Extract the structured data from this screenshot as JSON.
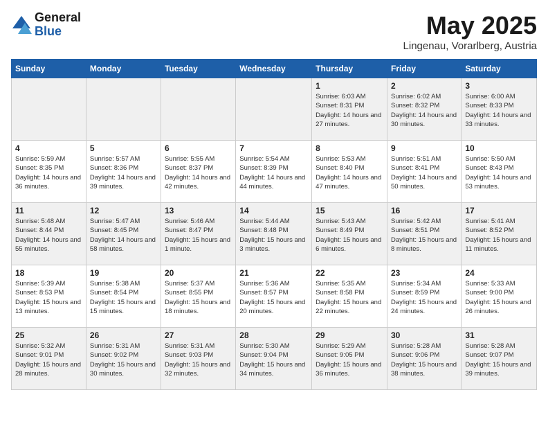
{
  "header": {
    "logo_general": "General",
    "logo_blue": "Blue",
    "month": "May 2025",
    "location": "Lingenau, Vorarlberg, Austria"
  },
  "days_of_week": [
    "Sunday",
    "Monday",
    "Tuesday",
    "Wednesday",
    "Thursday",
    "Friday",
    "Saturday"
  ],
  "weeks": [
    [
      {
        "day": "",
        "info": ""
      },
      {
        "day": "",
        "info": ""
      },
      {
        "day": "",
        "info": ""
      },
      {
        "day": "",
        "info": ""
      },
      {
        "day": "1",
        "info": "Sunrise: 6:03 AM\nSunset: 8:31 PM\nDaylight: 14 hours and 27 minutes."
      },
      {
        "day": "2",
        "info": "Sunrise: 6:02 AM\nSunset: 8:32 PM\nDaylight: 14 hours and 30 minutes."
      },
      {
        "day": "3",
        "info": "Sunrise: 6:00 AM\nSunset: 8:33 PM\nDaylight: 14 hours and 33 minutes."
      }
    ],
    [
      {
        "day": "4",
        "info": "Sunrise: 5:59 AM\nSunset: 8:35 PM\nDaylight: 14 hours and 36 minutes."
      },
      {
        "day": "5",
        "info": "Sunrise: 5:57 AM\nSunset: 8:36 PM\nDaylight: 14 hours and 39 minutes."
      },
      {
        "day": "6",
        "info": "Sunrise: 5:55 AM\nSunset: 8:37 PM\nDaylight: 14 hours and 42 minutes."
      },
      {
        "day": "7",
        "info": "Sunrise: 5:54 AM\nSunset: 8:39 PM\nDaylight: 14 hours and 44 minutes."
      },
      {
        "day": "8",
        "info": "Sunrise: 5:53 AM\nSunset: 8:40 PM\nDaylight: 14 hours and 47 minutes."
      },
      {
        "day": "9",
        "info": "Sunrise: 5:51 AM\nSunset: 8:41 PM\nDaylight: 14 hours and 50 minutes."
      },
      {
        "day": "10",
        "info": "Sunrise: 5:50 AM\nSunset: 8:43 PM\nDaylight: 14 hours and 53 minutes."
      }
    ],
    [
      {
        "day": "11",
        "info": "Sunrise: 5:48 AM\nSunset: 8:44 PM\nDaylight: 14 hours and 55 minutes."
      },
      {
        "day": "12",
        "info": "Sunrise: 5:47 AM\nSunset: 8:45 PM\nDaylight: 14 hours and 58 minutes."
      },
      {
        "day": "13",
        "info": "Sunrise: 5:46 AM\nSunset: 8:47 PM\nDaylight: 15 hours and 1 minute."
      },
      {
        "day": "14",
        "info": "Sunrise: 5:44 AM\nSunset: 8:48 PM\nDaylight: 15 hours and 3 minutes."
      },
      {
        "day": "15",
        "info": "Sunrise: 5:43 AM\nSunset: 8:49 PM\nDaylight: 15 hours and 6 minutes."
      },
      {
        "day": "16",
        "info": "Sunrise: 5:42 AM\nSunset: 8:51 PM\nDaylight: 15 hours and 8 minutes."
      },
      {
        "day": "17",
        "info": "Sunrise: 5:41 AM\nSunset: 8:52 PM\nDaylight: 15 hours and 11 minutes."
      }
    ],
    [
      {
        "day": "18",
        "info": "Sunrise: 5:39 AM\nSunset: 8:53 PM\nDaylight: 15 hours and 13 minutes."
      },
      {
        "day": "19",
        "info": "Sunrise: 5:38 AM\nSunset: 8:54 PM\nDaylight: 15 hours and 15 minutes."
      },
      {
        "day": "20",
        "info": "Sunrise: 5:37 AM\nSunset: 8:55 PM\nDaylight: 15 hours and 18 minutes."
      },
      {
        "day": "21",
        "info": "Sunrise: 5:36 AM\nSunset: 8:57 PM\nDaylight: 15 hours and 20 minutes."
      },
      {
        "day": "22",
        "info": "Sunrise: 5:35 AM\nSunset: 8:58 PM\nDaylight: 15 hours and 22 minutes."
      },
      {
        "day": "23",
        "info": "Sunrise: 5:34 AM\nSunset: 8:59 PM\nDaylight: 15 hours and 24 minutes."
      },
      {
        "day": "24",
        "info": "Sunrise: 5:33 AM\nSunset: 9:00 PM\nDaylight: 15 hours and 26 minutes."
      }
    ],
    [
      {
        "day": "25",
        "info": "Sunrise: 5:32 AM\nSunset: 9:01 PM\nDaylight: 15 hours and 28 minutes."
      },
      {
        "day": "26",
        "info": "Sunrise: 5:31 AM\nSunset: 9:02 PM\nDaylight: 15 hours and 30 minutes."
      },
      {
        "day": "27",
        "info": "Sunrise: 5:31 AM\nSunset: 9:03 PM\nDaylight: 15 hours and 32 minutes."
      },
      {
        "day": "28",
        "info": "Sunrise: 5:30 AM\nSunset: 9:04 PM\nDaylight: 15 hours and 34 minutes."
      },
      {
        "day": "29",
        "info": "Sunrise: 5:29 AM\nSunset: 9:05 PM\nDaylight: 15 hours and 36 minutes."
      },
      {
        "day": "30",
        "info": "Sunrise: 5:28 AM\nSunset: 9:06 PM\nDaylight: 15 hours and 38 minutes."
      },
      {
        "day": "31",
        "info": "Sunrise: 5:28 AM\nSunset: 9:07 PM\nDaylight: 15 hours and 39 minutes."
      }
    ]
  ]
}
